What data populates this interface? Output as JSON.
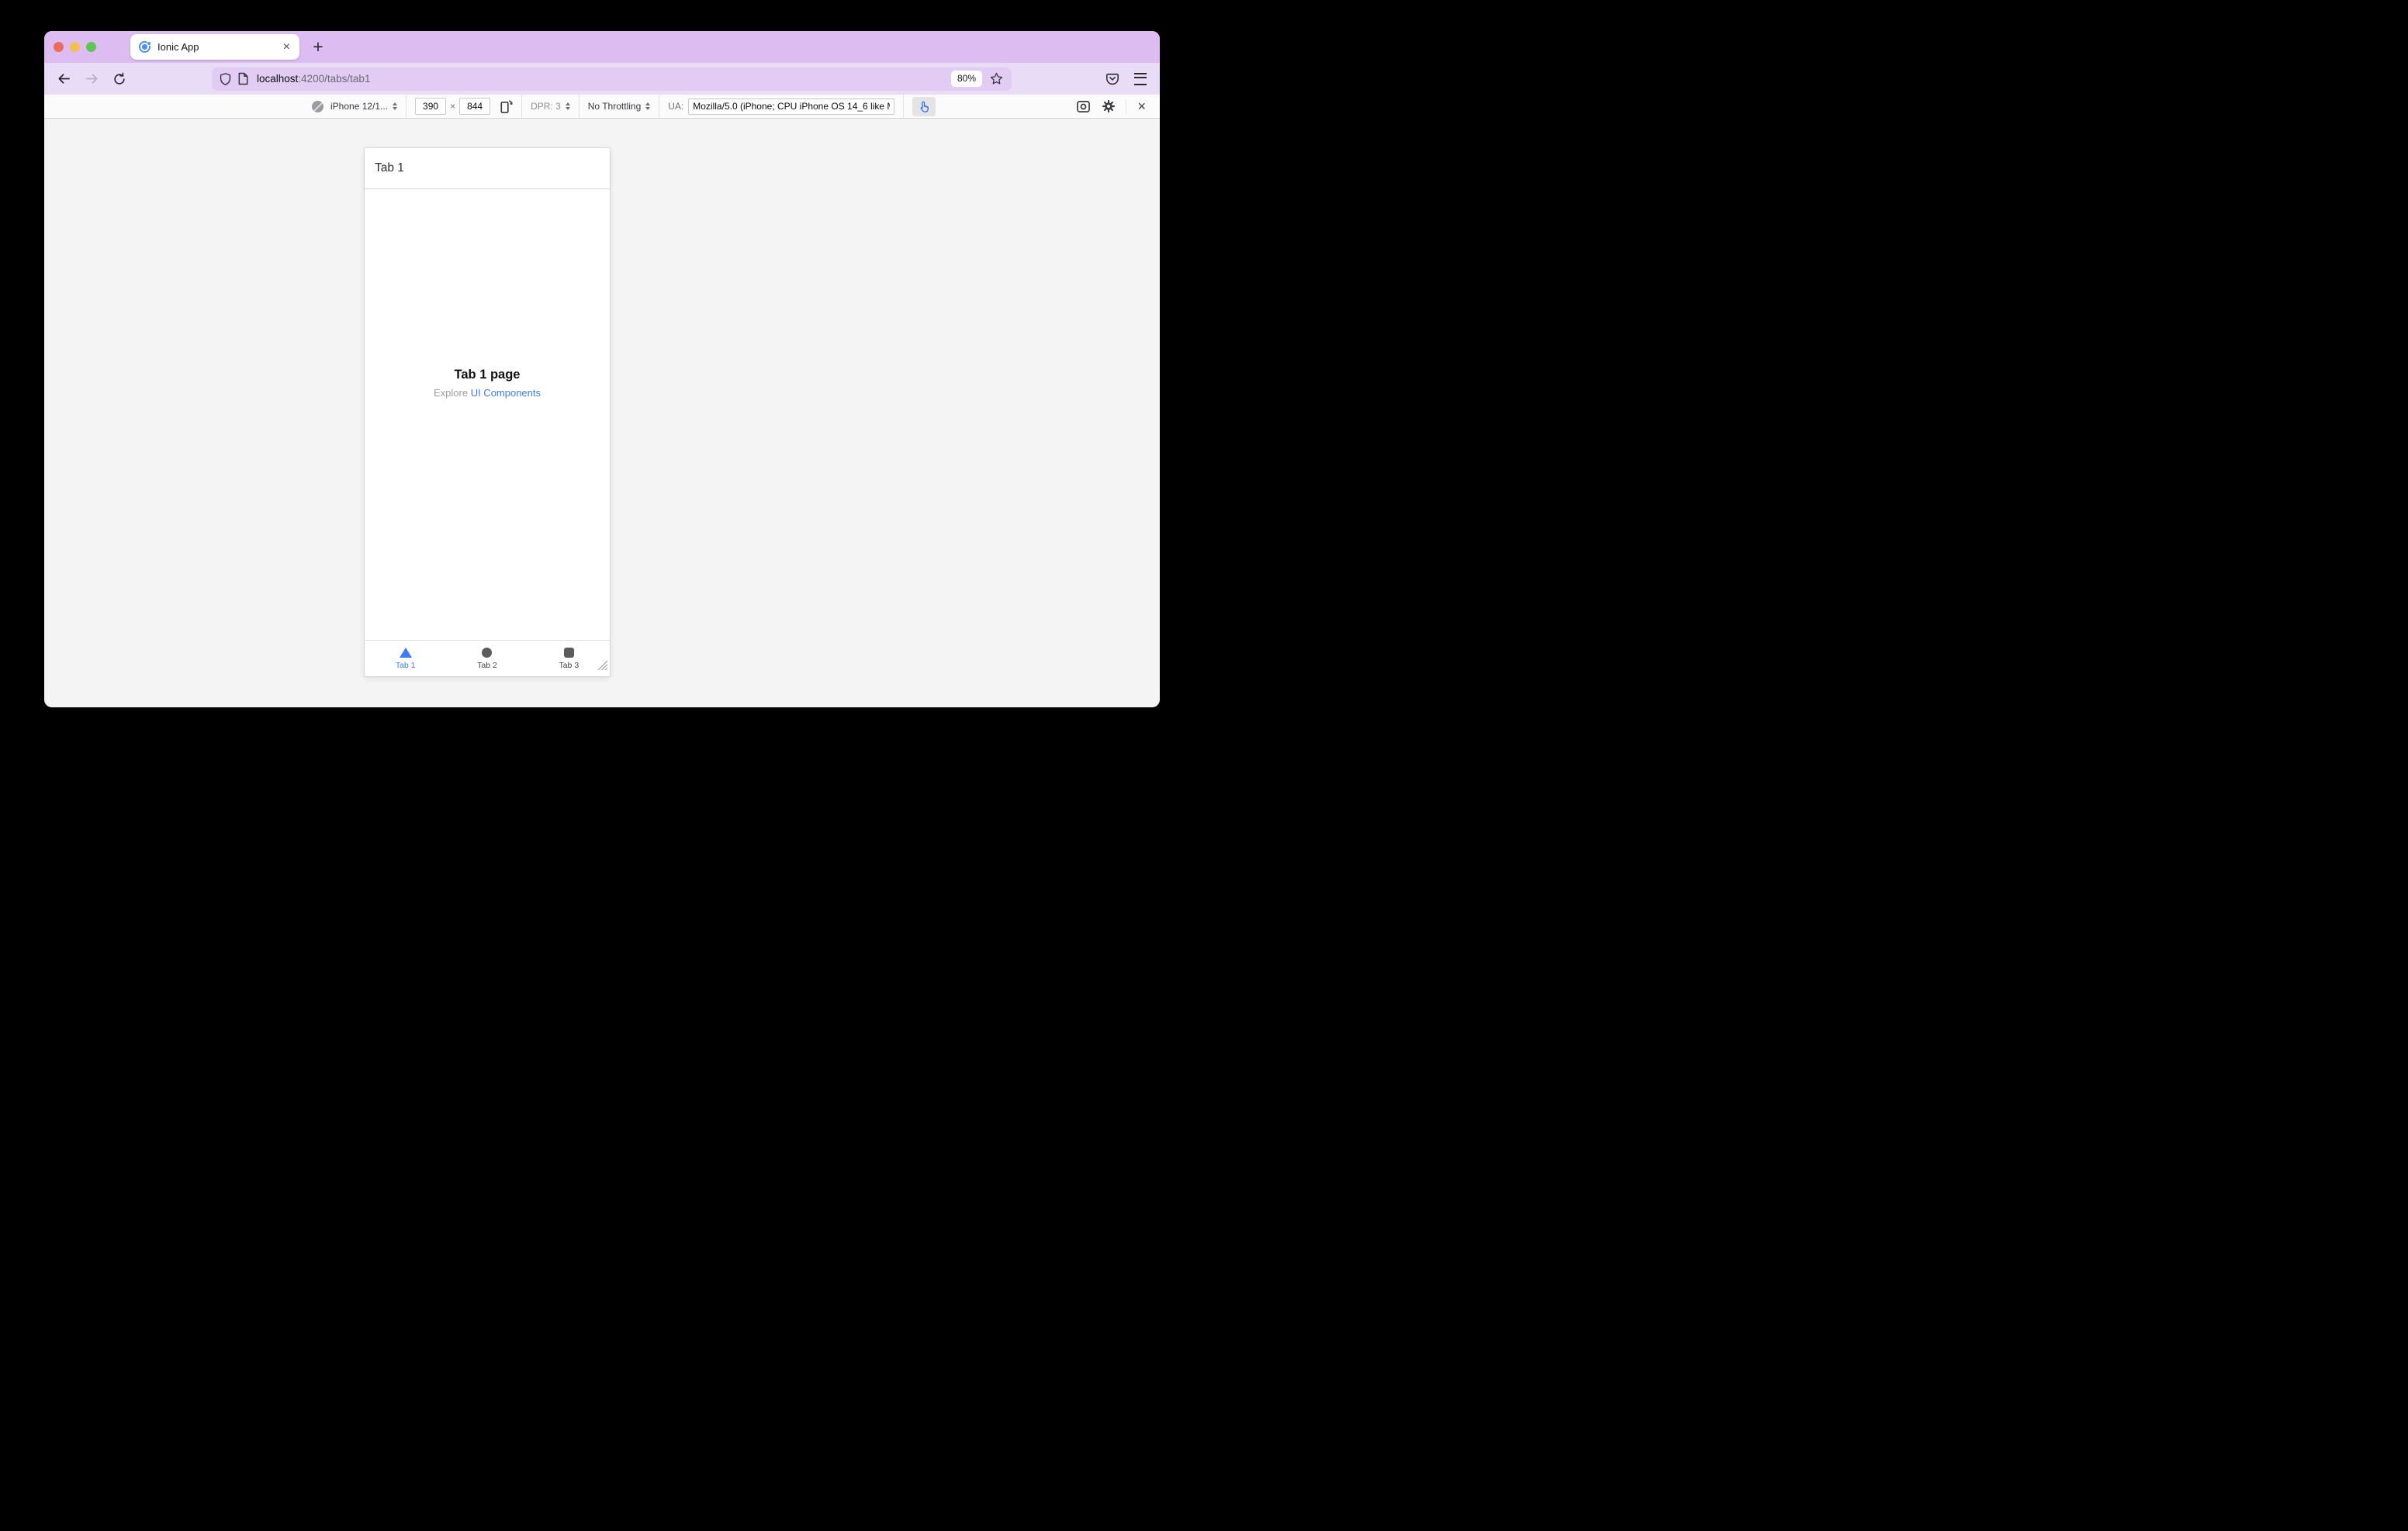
{
  "browser": {
    "tab_title": "Ionic App",
    "url_host": "localhost",
    "url_path": ":4200/tabs/tab1",
    "zoom_badge": "80%"
  },
  "icons": {
    "tab_close": "×",
    "new_tab": "+",
    "rdm_close": "×",
    "dim_separator": "×"
  },
  "rdm": {
    "device": "iPhone 12/1...",
    "viewport_width": "390",
    "viewport_height": "844",
    "dpr": "DPR: 3",
    "throttling": "No Throttling",
    "ua_label": "UA:",
    "ua_value": "Mozilla/5.0 (iPhone; CPU iPhone OS 14_6 like M"
  },
  "app": {
    "header_title": "Tab 1",
    "page_title": "Tab 1 page",
    "explore_text": "Explore",
    "explore_link": "UI Components",
    "tabs": [
      {
        "label": "Tab 1",
        "icon": "triangle",
        "active": true
      },
      {
        "label": "Tab 2",
        "icon": "circle",
        "active": false
      },
      {
        "label": "Tab 3",
        "icon": "square",
        "active": false
      }
    ]
  },
  "colors": {
    "titlebar": "#dcbcf1",
    "navbar": "#e9dcf7",
    "urlbar": "#e2ccf4",
    "accent_blue": "#3d7cf5",
    "traffic_red": "#ec6a5e",
    "traffic_yellow": "#f4bf50",
    "traffic_green": "#61c455"
  }
}
